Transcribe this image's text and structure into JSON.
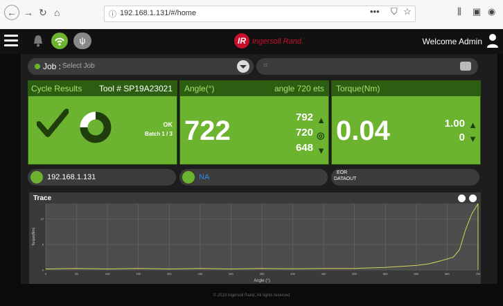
{
  "browser": {
    "url": "192.168.1.131/#/home",
    "menu_dots": "•••"
  },
  "header": {
    "brand": "Ingersoll Rand.",
    "welcome": "Welcome Admin"
  },
  "job": {
    "label": "Job :",
    "placeholder": "Select Job"
  },
  "cycle": {
    "title": "Cycle Results",
    "tool": "Tool # SP19A23021",
    "status": "OK",
    "batch": "Batch 1 / 3",
    "donut_fraction": 0.75
  },
  "angle": {
    "title": "Angle(°)",
    "subtitle": "angle 720 ets",
    "value": "722",
    "high": "792",
    "target": "720",
    "low": "648"
  },
  "torque": {
    "title": "Torque(Nm)",
    "value": "0.04",
    "high": "1.00",
    "low": "0"
  },
  "info": {
    "ip": "192.168.1.131",
    "na": "NA",
    "eor1": "EOR",
    "eor2": "DATAOUT"
  },
  "colors": {
    "panel_green": "#6cb430",
    "header_green": "#2c5e12",
    "accent_green": "#a6e36c",
    "trace_line": "#d6d65a",
    "na_blue": "#2d8cf0"
  },
  "chart_data": {
    "type": "line",
    "title": "Trace",
    "xlabel": "Angle (°)",
    "ylabel": "Torque(Nm)",
    "x_ticks": [
      "0",
      "50",
      "100",
      "150",
      "200",
      "250",
      "300",
      "350",
      "400",
      "450",
      "500",
      "550",
      "600",
      "650",
      "700"
    ],
    "y_ticks": [
      "0",
      "5",
      "10"
    ],
    "xlim": [
      0,
      700
    ],
    "ylim": [
      0,
      13
    ],
    "grid": true,
    "series": [
      {
        "values": [
          [
            0,
            0.2
          ],
          [
            50,
            0.3
          ],
          [
            100,
            0.2
          ],
          [
            150,
            0.3
          ],
          [
            200,
            0.2
          ],
          [
            250,
            0.3
          ],
          [
            300,
            0.2
          ],
          [
            350,
            0.3
          ],
          [
            400,
            0.25
          ],
          [
            450,
            0.3
          ],
          [
            500,
            0.3
          ],
          [
            550,
            0.5
          ],
          [
            600,
            0.9
          ],
          [
            620,
            1.2
          ],
          [
            640,
            1.8
          ],
          [
            660,
            2.5
          ],
          [
            670,
            4.0
          ],
          [
            680,
            8.0
          ],
          [
            690,
            11.0
          ],
          [
            700,
            13.0
          ],
          [
            700,
            0
          ]
        ]
      }
    ]
  },
  "footer": {
    "text": "© 2019 Ingersoll Rand, All rights reserved"
  }
}
